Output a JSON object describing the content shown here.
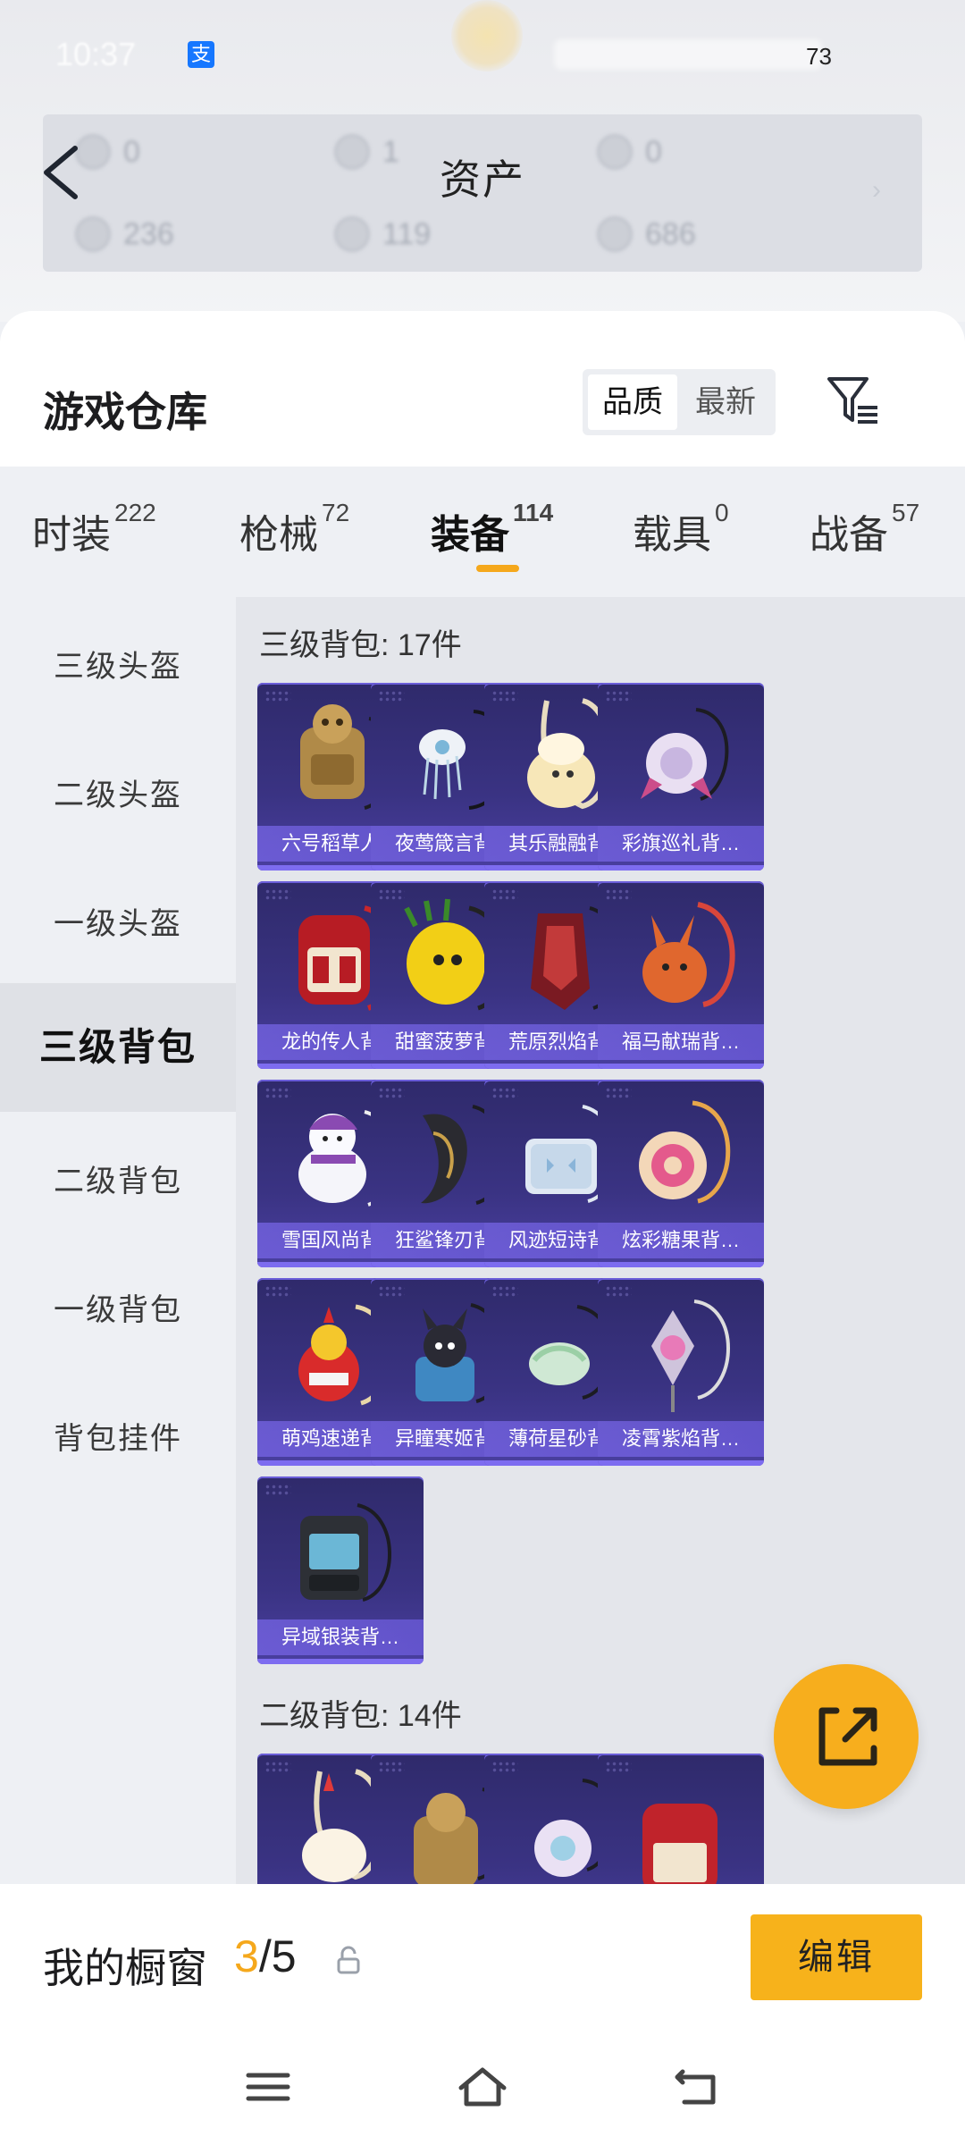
{
  "status_bar": {
    "time": "10:37",
    "pay_icon": "alipay-icon",
    "battery": "73"
  },
  "assets": {
    "title": "资产",
    "items": [
      {
        "value": "0"
      },
      {
        "value": "1"
      },
      {
        "value": "0"
      },
      {
        "value": "236"
      },
      {
        "value": "119"
      },
      {
        "value": "686"
      }
    ]
  },
  "warehouse": {
    "title": "游戏仓库",
    "sort_options": [
      "品质",
      "最新"
    ],
    "tabs": [
      {
        "label": "时装",
        "count": "222"
      },
      {
        "label": "枪械",
        "count": "72"
      },
      {
        "label": "装备",
        "count": "114"
      },
      {
        "label": "载具",
        "count": "0"
      },
      {
        "label": "战备",
        "count": "57"
      }
    ],
    "active_tab": "装备",
    "sidebar": [
      "三级头盔",
      "二级头盔",
      "一级头盔",
      "三级背包",
      "二级背包",
      "一级背包",
      "背包挂件"
    ],
    "active_side": "三级背包",
    "sections": [
      {
        "label": "三级背包: 17件",
        "items": [
          "六号稻草人…",
          "夜莺箴言背…",
          "其乐融融背…",
          "彩旗巡礼背…",
          "龙的传人背…",
          "甜蜜菠萝背…",
          "荒原烈焰背…",
          "福马献瑞背…",
          "雪国风尚背…",
          "狂鲨锋刃背…",
          "风迹短诗背…",
          "炫彩糖果背…",
          "萌鸡速递背…",
          "异瞳寒姬背…",
          "薄荷星砂背…",
          "凌霄紫焰背…",
          "异域银装背…"
        ]
      },
      {
        "label": "二级背包: 14件",
        "items": []
      }
    ]
  },
  "showcase": {
    "label": "我的橱窗",
    "current": "3",
    "total": "/5",
    "edit_label": "编辑"
  },
  "colors": {
    "accent": "#f5a81c",
    "card_bg": "#3a3383"
  }
}
